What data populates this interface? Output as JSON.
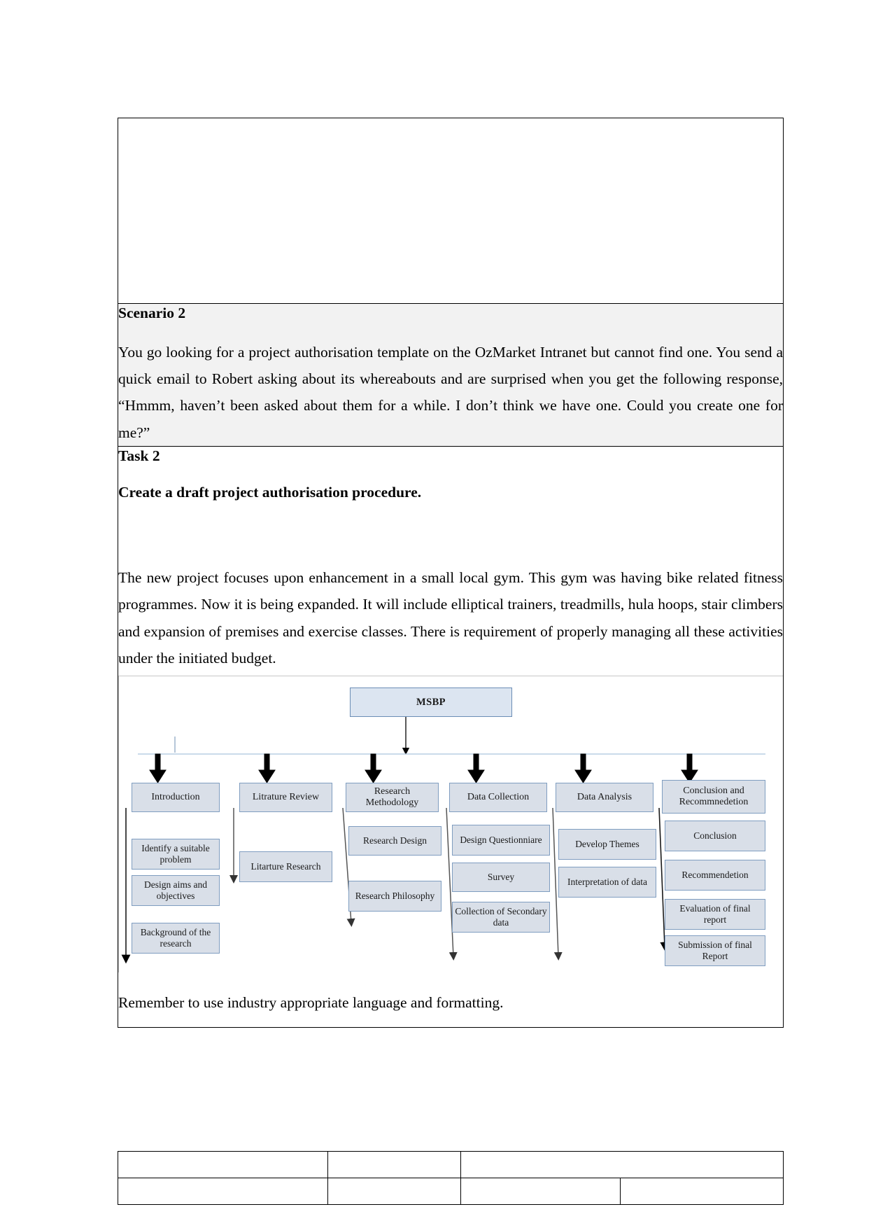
{
  "document": {
    "top_cell_empty": true,
    "scenario": {
      "heading": "Scenario 2",
      "body": "You go looking for a project authorisation template on the OzMarket Intranet but cannot find one. You send a quick email to Robert asking about its whereabouts and are surprised when you get the following response, “Hmmm, haven’t been asked about them for a while. I don’t think we have one. Could you create one for me?”"
    },
    "task": {
      "heading": "Task 2",
      "subheading": "Create a draft project authorisation procedure.",
      "body": "The new project focuses upon enhancement in a small local gym. This gym was having bike related fitness programmes. Now it is being expanded. It will include elliptical trainers, treadmills, hula hoops, stair climbers and expansion of premises and exercise classes. There is requirement of properly managing all these activities under the initiated budget.",
      "closing": "Remember to use industry appropriate language and formatting."
    }
  },
  "chart_data": {
    "type": "diagram",
    "title": "MSBP",
    "root": "MSBP",
    "branches": [
      {
        "label": "Introduction",
        "children": [
          "Identify a suitable problem",
          "Design aims and objectives",
          "Background of the research"
        ]
      },
      {
        "label": "Litrature Review",
        "children": [
          "Litarture Research"
        ]
      },
      {
        "label": "Research Methodology",
        "children": [
          "Research Design",
          "Research Philosophy"
        ]
      },
      {
        "label": "Data Collection",
        "children": [
          "Design Questionniare",
          "Survey",
          "Collection of Secondary data"
        ]
      },
      {
        "label": "Data Analysis",
        "children": [
          "Develop Themes",
          "Interpretation of data"
        ]
      },
      {
        "label": "Conclusion and Recommnedetion",
        "children": [
          "Conclusion",
          "Recommendetion",
          "Evaluation of final report",
          "Submission of final Report"
        ]
      }
    ],
    "colors": {
      "node_fill": "#d9dfe8",
      "node_border": "#7f9dc0",
      "root_fill": "#dce5f1",
      "connector": "#000000"
    },
    "note": "right-most branch is clipped by the page frame"
  },
  "bottom_table": {
    "rows": [
      {
        "cells": [
          "",
          "",
          ""
        ]
      },
      {
        "cells": [
          "",
          "",
          "",
          ""
        ]
      }
    ]
  }
}
